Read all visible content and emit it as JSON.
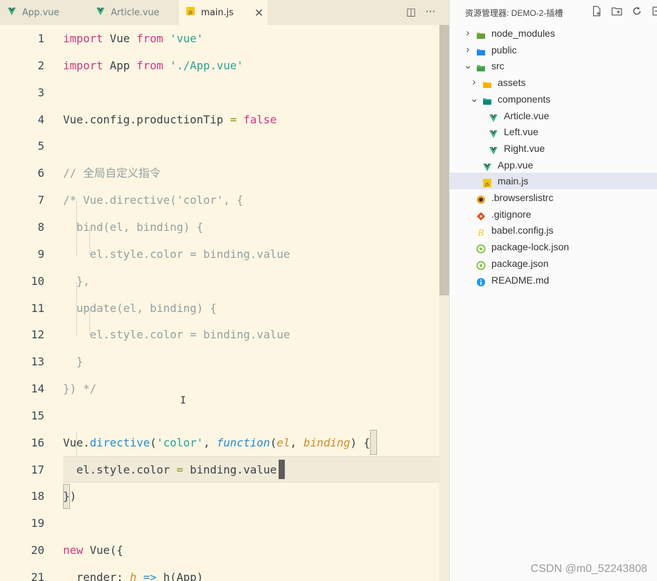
{
  "tabs": [
    {
      "label": "App.vue",
      "icon": "vue-icon"
    },
    {
      "label": "Article.vue",
      "icon": "vue-icon"
    },
    {
      "label": "main.js",
      "icon": "js-icon",
      "active": true
    }
  ],
  "tab_close": "✕",
  "tab_tools": {
    "split": "◫",
    "more": "···"
  },
  "code_lines": [
    {
      "n": "1",
      "html": "<span class=\"kw\">import</span> Vue <span class=\"kw\">from</span> <span class=\"str\">'vue'</span>"
    },
    {
      "n": "2",
      "html": "<span class=\"kw\">import</span> App <span class=\"kw\">from</span> <span class=\"str\">'./App.vue'</span>"
    },
    {
      "n": "3",
      "html": ""
    },
    {
      "n": "4",
      "html": "Vue.config.productionTip <span class=\"op\">=</span> <span class=\"bool\">false</span>"
    },
    {
      "n": "5",
      "html": ""
    },
    {
      "n": "6",
      "html": "<span class=\"cm\">// 全局自定义指令</span>"
    },
    {
      "n": "7",
      "html": "<span class=\"cm\">/* Vue.directive('color', {</span>"
    },
    {
      "n": "8",
      "html": "<span class=\"cm\">  bind(el, binding) {</span>"
    },
    {
      "n": "9",
      "html": "<span class=\"cm\">    el.style.color = binding.value</span>"
    },
    {
      "n": "10",
      "html": "<span class=\"cm\">  },</span>"
    },
    {
      "n": "11",
      "html": "<span class=\"cm\">  update(el, binding) {</span>"
    },
    {
      "n": "12",
      "html": "<span class=\"cm\">    el.style.color = binding.value</span>"
    },
    {
      "n": "13",
      "html": "<span class=\"cm\">  }</span>"
    },
    {
      "n": "14",
      "html": "<span class=\"cm\">}) */</span>"
    },
    {
      "n": "15",
      "html": ""
    },
    {
      "n": "16",
      "html": "Vue.<span class=\"fn\">directive</span>(<span class=\"str\">'color'</span>, <span class=\"kwi\">function</span>(<span class=\"prm\">el</span>, <span class=\"prm\">binding</span>) {"
    },
    {
      "n": "17",
      "html": "  el.style.color <span class=\"op\">=</span> binding.value"
    },
    {
      "n": "18",
      "html": "})"
    },
    {
      "n": "19",
      "html": ""
    },
    {
      "n": "20",
      "html": "<span class=\"kw\">new</span> Vue({"
    },
    {
      "n": "21",
      "html": "  render: <span class=\"prm\">h</span> <span class=\"kwi\">=&gt;</span> h(App)"
    }
  ],
  "explorer": {
    "title": "资源管理器: DEMO-2-插槽",
    "tools": [
      "new-file-icon",
      "new-folder-icon",
      "refresh-icon",
      "collapse-icon"
    ],
    "items": [
      {
        "label": "node_modules",
        "icon": "folder-node-icon",
        "depth": 0,
        "chevron": "right"
      },
      {
        "label": "public",
        "icon": "folder-public-icon",
        "depth": 0,
        "chevron": "right"
      },
      {
        "label": "src",
        "icon": "folder-src-icon",
        "depth": 0,
        "chevron": "down"
      },
      {
        "label": "assets",
        "icon": "folder-assets-icon",
        "depth": 1,
        "chevron": "right"
      },
      {
        "label": "components",
        "icon": "folder-components-icon",
        "depth": 1,
        "chevron": "down"
      },
      {
        "label": "Article.vue",
        "icon": "vue-icon",
        "depth": 2,
        "chevron": ""
      },
      {
        "label": "Left.vue",
        "icon": "vue-icon",
        "depth": 2,
        "chevron": ""
      },
      {
        "label": "Right.vue",
        "icon": "vue-icon",
        "depth": 2,
        "chevron": ""
      },
      {
        "label": "App.vue",
        "icon": "vue-icon",
        "depth": 1,
        "chevron": ""
      },
      {
        "label": "main.js",
        "icon": "js-icon",
        "depth": 1,
        "chevron": "",
        "selected": true
      },
      {
        "label": ".browserslistrc",
        "icon": "browserslist-icon",
        "depth": 0,
        "chevron": ""
      },
      {
        "label": ".gitignore",
        "icon": "git-icon",
        "depth": 0,
        "chevron": ""
      },
      {
        "label": "babel.config.js",
        "icon": "babel-icon",
        "depth": 0,
        "chevron": ""
      },
      {
        "label": "package-lock.json",
        "icon": "npm-json-icon",
        "depth": 0,
        "chevron": ""
      },
      {
        "label": "package.json",
        "icon": "npm-json-icon",
        "depth": 0,
        "chevron": ""
      },
      {
        "label": "README.md",
        "icon": "info-icon",
        "depth": 0,
        "chevron": ""
      }
    ]
  },
  "watermark": "CSDN @m0_52243808",
  "colors": {
    "vue": "#41b883",
    "js": "#f5c518",
    "editor_bg": "#fdf6e3"
  }
}
